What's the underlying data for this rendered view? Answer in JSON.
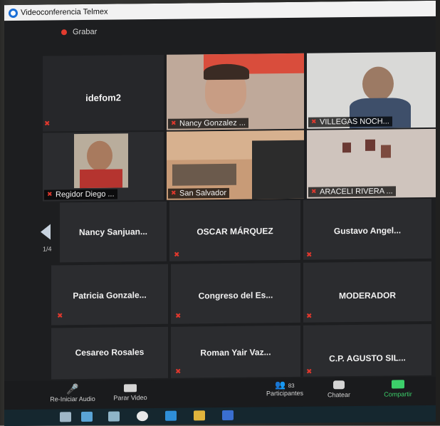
{
  "window": {
    "title": "Videoconferencia Telmex"
  },
  "recording": {
    "label": "Grabar"
  },
  "pagination": {
    "label": "1/4"
  },
  "participants_top": [
    {
      "name": "idefom2"
    }
  ],
  "video_tiles": [
    {
      "name": "Nancy Gonzalez ..."
    },
    {
      "name": "VILLEGAS NOCH..."
    },
    {
      "name": "Regidor Diego ..."
    },
    {
      "name": "San Salvador"
    },
    {
      "name": "ARACELI RIVERA ..."
    }
  ],
  "name_tiles": [
    {
      "name": "Nancy Sanjuan..."
    },
    {
      "name": "OSCAR MÁRQUEZ"
    },
    {
      "name": "Gustavo Angel..."
    },
    {
      "name": "Patricia Gonzale..."
    },
    {
      "name": "Congreso del Es..."
    },
    {
      "name": "MODERADOR"
    },
    {
      "name": "Cesareo Rosales"
    },
    {
      "name": "Roman Yair Vaz..."
    },
    {
      "name": "C.P. AGUSTO SIL..."
    }
  ],
  "toolbar": {
    "audio_label": "Re-Iniciar Audio",
    "video_label": "Parar Video",
    "participants_label": "Participantes",
    "participants_count": "83",
    "chat_label": "Chatear",
    "share_label": "Compartir"
  },
  "colors": {
    "mute": "#e0382d",
    "share": "#3ccf6a",
    "tile": "#2b2c2f"
  }
}
